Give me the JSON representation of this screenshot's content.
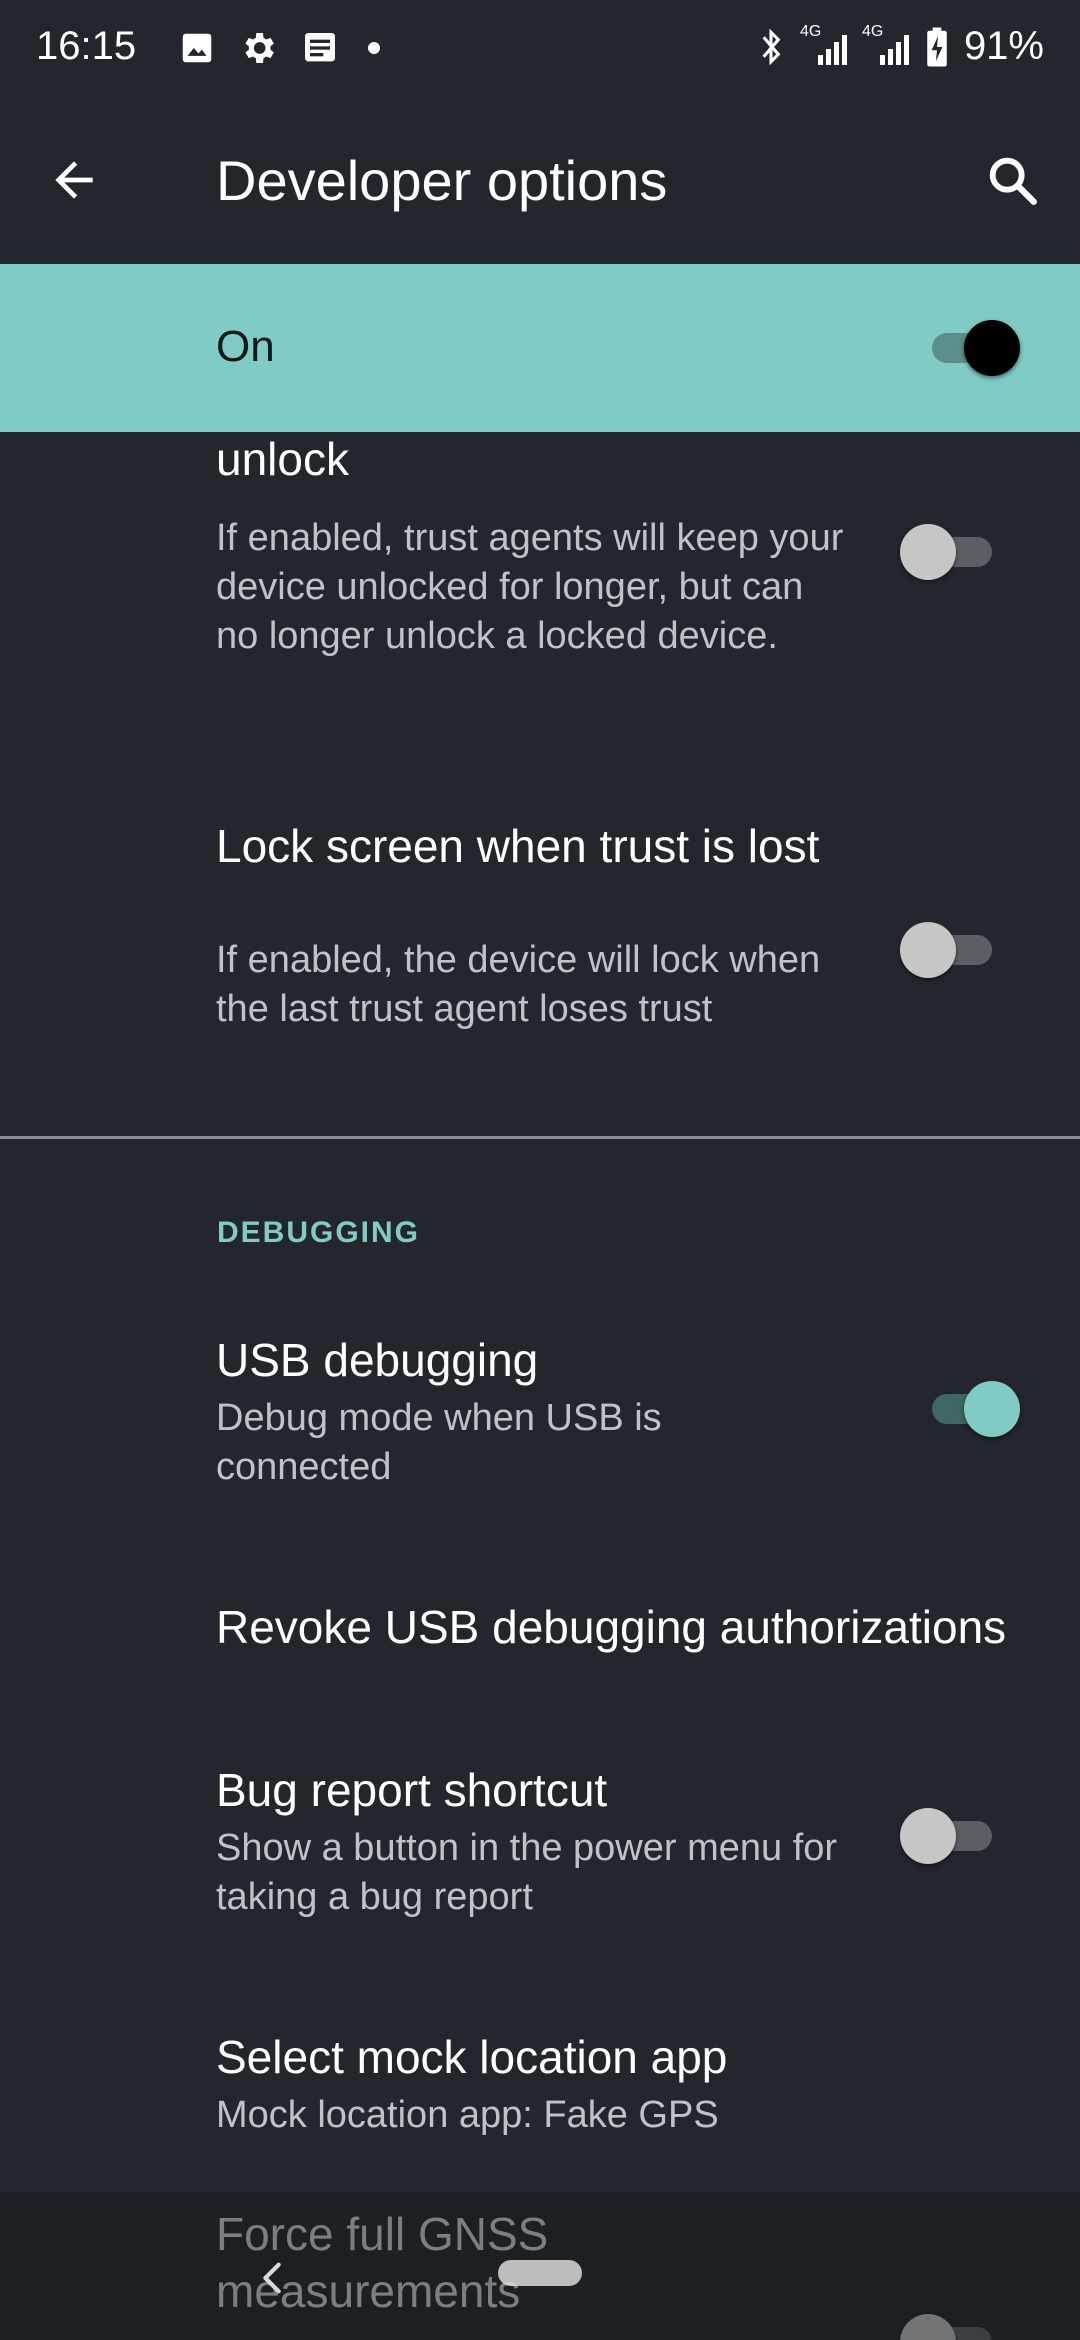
{
  "status_bar": {
    "time": "16:15",
    "left_icons": [
      "image-icon",
      "gear-icon",
      "message-icon",
      "dot-icon"
    ],
    "right_icons": [
      "bluetooth-icon",
      "signal-4g-icon",
      "signal-4g-icon",
      "battery-charging-icon"
    ],
    "network_label_1": "4G",
    "network_label_2": "4G",
    "battery": "91%"
  },
  "app_bar": {
    "title": "Developer options",
    "back_icon": "arrow-back-icon",
    "search_icon": "search-icon"
  },
  "master_switch": {
    "label": "On",
    "checked": true
  },
  "items": [
    {
      "title": "Trust agents only extend unlock",
      "summary": "If enabled, trust agents will keep your device unlocked for longer, but can no longer unlock a locked device.",
      "checked": false
    },
    {
      "title": "Lock screen when trust is lost",
      "summary": "If enabled, the device will lock when the last trust agent loses trust",
      "checked": false
    }
  ],
  "debugging": {
    "header": "DEBUGGING",
    "items": [
      {
        "title": "USB debugging",
        "summary": "Debug mode when USB is connected",
        "checked": true
      },
      {
        "title": "Revoke USB debugging authorizations"
      },
      {
        "title": "Bug report shortcut",
        "summary": "Show a button in the power menu for taking a bug report",
        "checked": false
      },
      {
        "title": "Select mock location app",
        "summary": "Mock location app: Fake GPS"
      },
      {
        "title": "Force full GNSS measurements",
        "checked": false
      }
    ]
  },
  "colors": {
    "background": "#23272d",
    "accent": "#80cbc4",
    "text_primary": "#ffffff",
    "text_secondary": "#bfc3c7"
  }
}
